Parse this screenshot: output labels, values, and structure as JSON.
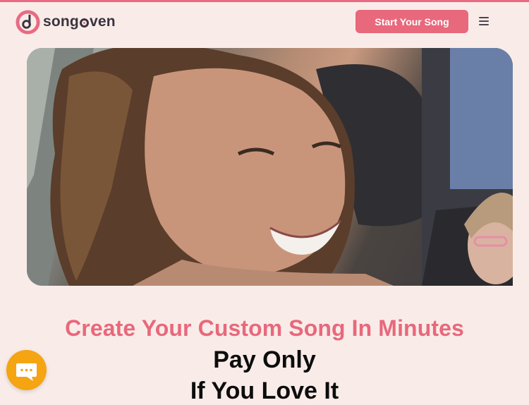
{
  "brand": {
    "name_pre": "song",
    "name_post": "ven"
  },
  "header": {
    "cta_label": "Start Your Song",
    "menu_icon": "hamburger-menu-icon"
  },
  "hero": {
    "media": "video-thumbnail",
    "subject": "smiling woman in car"
  },
  "headline": "Create Your Custom Song In Minutes",
  "subheadline_line1": "Pay Only",
  "subheadline_line2": "If You Love It",
  "chat": {
    "icon": "chat-icon"
  },
  "colors": {
    "accent": "#e8687c",
    "background": "#f9ece8",
    "chat": "#f5a412",
    "text": "#0d0d0d"
  }
}
